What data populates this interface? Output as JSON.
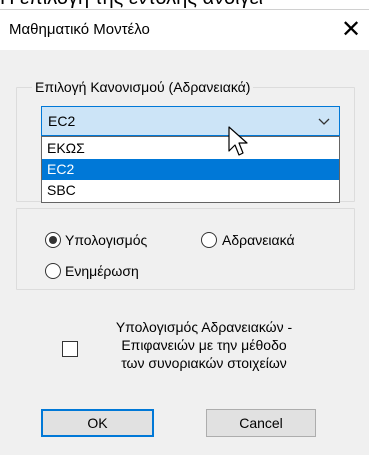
{
  "background_caption": "Η επιλογή της εντολής ανοίγει",
  "dialog": {
    "title": "Μαθηματικό Μοντέλο",
    "close_glyph": "✕"
  },
  "regulation_group": {
    "label": "Επιλογή Κανονισμού (Αδρανειακά)",
    "selected_value": "EC2",
    "options": [
      "ΕΚΩΣ",
      "EC2",
      "SBC"
    ],
    "selected_index": 1
  },
  "mode_group": {
    "options": [
      {
        "label": "Υπολογισμός",
        "checked": true
      },
      {
        "label": "Αδρανειακά",
        "checked": false
      },
      {
        "label": "Ενημέρωση",
        "checked": false
      }
    ]
  },
  "boundary_option": {
    "label_lines": [
      "Υπολογισμός Αδρανειακών -",
      "Επιφανειών με την μέθοδο",
      "των συνοριακών στοιχείων"
    ],
    "checked": false
  },
  "buttons": {
    "ok": "OK",
    "cancel": "Cancel"
  },
  "colors": {
    "accent": "#0078d7",
    "selection_bg": "#cce4f7",
    "dialog_bg": "#f0f0f0"
  }
}
